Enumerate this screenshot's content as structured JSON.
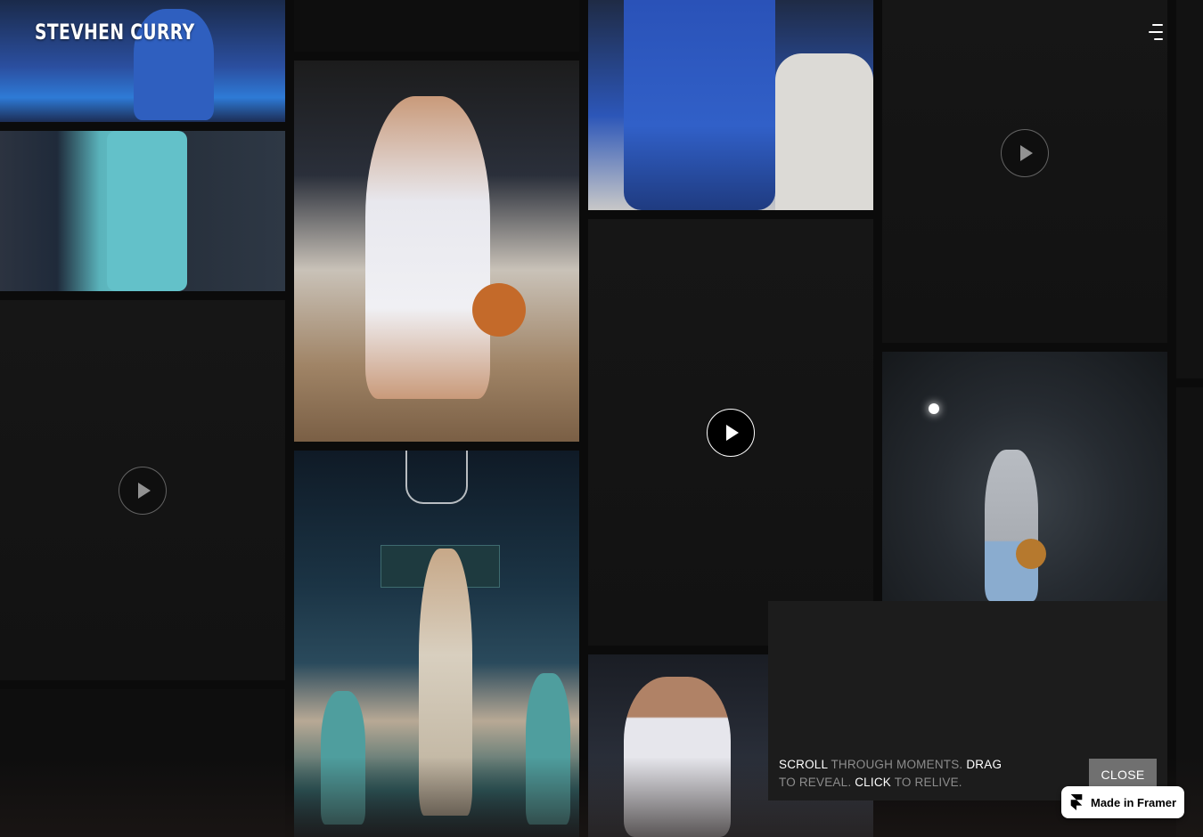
{
  "brand": {
    "title": "STEVHEN CURRY"
  },
  "menu": {
    "icon": "menu-icon"
  },
  "tiles": {
    "video_icon": "play-icon"
  },
  "info": {
    "line_parts": [
      {
        "text": "SCROLL",
        "highlight": true
      },
      {
        "text": " THROUGH MOMENTS. ",
        "highlight": false
      },
      {
        "text": "DRAG",
        "highlight": true
      },
      {
        "text": " TO REVEAL. ",
        "highlight": false
      },
      {
        "text": "CLICK",
        "highlight": true
      },
      {
        "text": " TO RELIVE.",
        "highlight": false
      }
    ],
    "close_label": "CLOSE"
  },
  "framer": {
    "label": "Made in Framer",
    "icon": "framer-logo-icon"
  },
  "colors": {
    "background": "#0b0b0b",
    "panel": "#1c1c1c",
    "close_button": "#707070",
    "accent_text": "#ffffff",
    "muted_text": "#8d8d8d"
  }
}
